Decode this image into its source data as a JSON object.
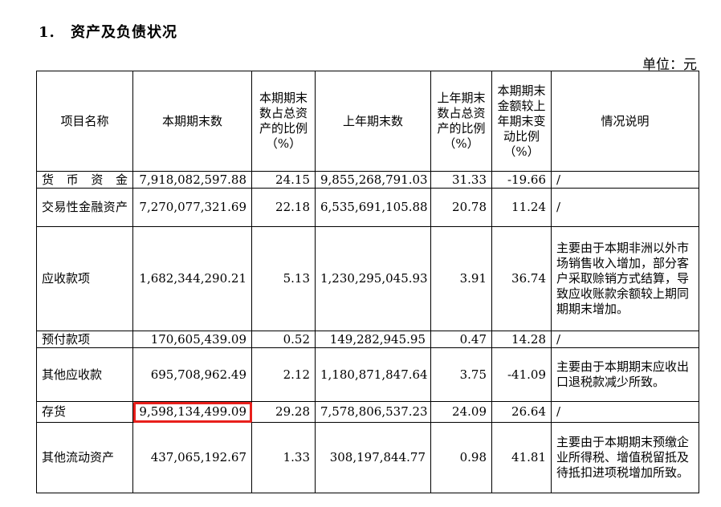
{
  "section": {
    "number": "1.",
    "title": "资产及负债状况"
  },
  "unit": "单位：元",
  "headers": [
    "项目名称",
    "本期期末数",
    "本期期末数占总资产的比例（%）",
    "上年期末数",
    "上年期末数占总资产的比例（%）",
    "本期期末金额较上年期末变动比例（%）",
    "情况说明"
  ],
  "rows": [
    {
      "name": "货币资金",
      "current": "7,918,082,597.88",
      "current_pct": "24.15",
      "prior": "9,855,268,791.03",
      "prior_pct": "31.33",
      "change": "-19.66",
      "note": "/"
    },
    {
      "name": "交易性金融资产",
      "current": "7,270,077,321.69",
      "current_pct": "22.18",
      "prior": "6,535,691,105.88",
      "prior_pct": "20.78",
      "change": "11.24",
      "note": "/"
    },
    {
      "name": "应收款项",
      "current": "1,682,344,290.21",
      "current_pct": "5.13",
      "prior": "1,230,295,045.93",
      "prior_pct": "3.91",
      "change": "36.74",
      "note": "主要由于本期非洲以外市场销售收入增加，部分客户采取赊销方式结算，导致应收账款余额较上期同期期末增加。"
    },
    {
      "name": "预付款项",
      "current": "170,605,439.09",
      "current_pct": "0.52",
      "prior": "149,282,945.95",
      "prior_pct": "0.47",
      "change": "14.28",
      "note": "/"
    },
    {
      "name": "其他应收款",
      "current": "695,708,962.49",
      "current_pct": "2.12",
      "prior": "1,180,871,847.64",
      "prior_pct": "3.75",
      "change": "-41.09",
      "note": "主要由于本期期末应收出口退税款减少所致。"
    },
    {
      "name": "存货",
      "current": "9,598,134,499.09",
      "current_pct": "29.28",
      "prior": "7,578,806,537.23",
      "prior_pct": "24.09",
      "change": "26.64",
      "note": "/"
    },
    {
      "name": "其他流动资产",
      "current": "437,065,192.67",
      "current_pct": "1.33",
      "prior": "308,197,844.77",
      "prior_pct": "0.98",
      "change": "41.81",
      "note": "主要由于本期期末预缴企业所得税、增值税留抵及待抵扣进项税增加所致。"
    }
  ],
  "highlight_color": "#e8201c"
}
